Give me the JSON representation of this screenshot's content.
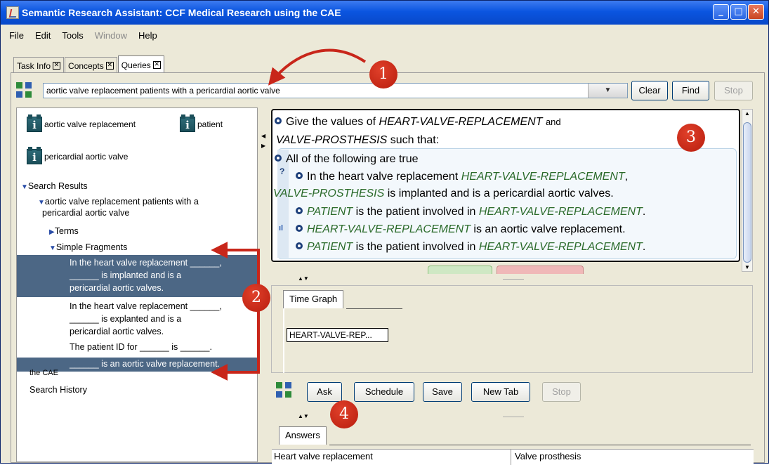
{
  "window": {
    "title": "Semantic Research Assistant: CCF Medical Research using the CAE"
  },
  "window_buttons": {
    "minimize": "_",
    "maximize": "□",
    "close": "✕"
  },
  "menu": [
    "File",
    "Edit",
    "Tools",
    "Window",
    "Help"
  ],
  "tabs": [
    {
      "label": "Task Info"
    },
    {
      "label": "Concepts"
    },
    {
      "label": "Queries"
    }
  ],
  "query": {
    "value": "aortic valve replacement  patients with a pericardial aortic valve",
    "clear_label": "Clear",
    "find_label": "Find",
    "stop_label": "Stop"
  },
  "concepts": [
    {
      "label": "aortic valve replacement"
    },
    {
      "label": "patient"
    },
    {
      "label": "pericardial aortic valve"
    }
  ],
  "tree": {
    "root": "Search Results",
    "query_node_1": "aortic valve replacement patients with a",
    "query_node_2": "pericardial aortic valve",
    "terms": "Terms",
    "simple_fragments": "Simple Fragments",
    "fragments": [
      [
        "In the heart valve replacement ______,",
        "______ is implanted and is a",
        "pericardial aortic valves."
      ],
      [
        "In the heart valve replacement ______,",
        "______ is explanted and is a",
        "pericardial aortic valves."
      ],
      [
        "The patient ID for ______ is ______."
      ],
      [
        "______ is an aortic valve replacement."
      ]
    ],
    "cae": "the CAE",
    "history": "Search History"
  },
  "query_panel": {
    "intro_1": "Give the values of",
    "var_hvr": "HEART-VALVE-REPLACEMENT",
    "and": "and",
    "var_vp": "VALVE-PROSTHESIS",
    "such_that": "such that:",
    "all_true": "All of the following are true",
    "c1_pre": "In the heart valve replacement",
    "c1_post": ",",
    "c1b_post": "is implanted and is a pericardial aortic valves.",
    "var_patient": "PATIENT",
    "c2_mid": "is the patient involved in",
    "c2_end": ".",
    "c3_post": "is an aortic valve replacement.",
    "question_mark": "?",
    "bars_glyph": "ıl"
  },
  "graph": {
    "tab": "Time Graph",
    "node": "HEART-VALVE-REP..."
  },
  "actions": {
    "ask": "Ask",
    "schedule": "Schedule",
    "save": "Save",
    "new_tab": "New Tab",
    "stop": "Stop"
  },
  "answers": {
    "tab": "Answers",
    "columns": [
      "Heart valve replacement",
      "Valve prosthesis"
    ]
  },
  "callouts": [
    "1",
    "2",
    "3",
    "4"
  ],
  "colors": {
    "title_bar": "#0b55e0",
    "selection": "#4c6785",
    "callout": "#c8261a",
    "variable": "#2a6a2a"
  }
}
